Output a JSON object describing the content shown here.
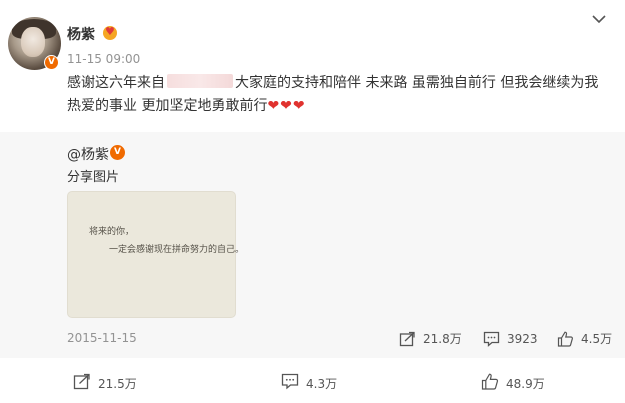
{
  "post": {
    "username": "杨紫",
    "timestamp": "11-15 09:00",
    "verified_badge": "V",
    "content_before": "感谢这六年来自",
    "content_after": "大家庭的支持和陪伴 未来路 虽需独自前行 但我会继续为我热爱的事业 更加坚定地勇敢前行",
    "content_hearts": "❤❤❤"
  },
  "repost": {
    "user": "@杨紫",
    "text": "分享图片",
    "image_line1": "将来的你，",
    "image_line2": "一定会感谢现在拼命努力的自己。",
    "date": "2015-11-15",
    "share_count": "21.8万",
    "comment_count": "3923",
    "like_count": "4.5万"
  },
  "actions": {
    "share_count": "21.5万",
    "comment_count": "4.3万",
    "like_count": "48.9万"
  },
  "icons": {
    "menu": "chevron-down-icon",
    "share": "share-icon",
    "comment": "comment-icon",
    "like": "thumbs-up-icon"
  },
  "colors": {
    "verified": "#f06a00",
    "heart": "#e0322f",
    "muted_text": "#939393",
    "card_bg": "#f7f7f7"
  }
}
